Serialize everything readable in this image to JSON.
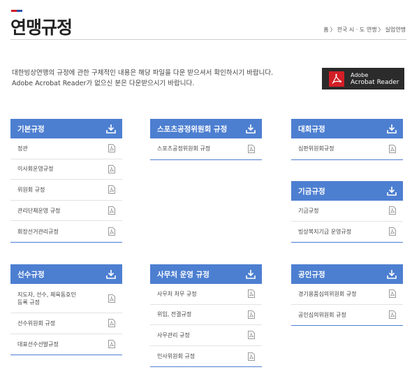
{
  "colors": {
    "accent_red": "#d31f26",
    "accent_blue": "#2c4fa6",
    "panel_header": "#4d7fd1"
  },
  "header": {
    "title": "연맹규정",
    "breadcrumb": [
      "홈",
      "전국 시 · 도 연맹",
      "실업연맹"
    ]
  },
  "intro": {
    "line1": "대한빙상연맹의 규정에 관한 구체적인 내용은 해당 파일을 다운 받으셔서 확인하시기 바랍니다.",
    "line2": "Adobe Acrobat Reader가 없으신 분은 다운받으시기 바랍니다."
  },
  "adobe": {
    "line1": "Adobe",
    "line2": "Acrobat Reader",
    "icon": "adobe-acrobat-icon"
  },
  "panels": [
    {
      "title": "기본규정",
      "items": [
        "정관",
        "이사회운영규정",
        "위원회 규정",
        "관리단체운영 규정",
        "회장선거관리규정"
      ]
    },
    {
      "title": "스포츠공정위원회 규정",
      "items": [
        "스포츠공정위원회 규정"
      ]
    },
    {
      "title": "대회규정",
      "items": [
        "심판위원회규정"
      ]
    },
    {
      "title": "기금규정",
      "items": [
        "기금규정",
        "빙상복지기금 운영규정"
      ]
    },
    {
      "title": "선수규정",
      "items": [
        "지도자, 선수, 체육동호인\n등록 규정",
        "선수위원회 규정",
        "대표선수선발규정"
      ]
    },
    {
      "title": "사무처 운영 규정",
      "items": [
        "사무처 처무 규정",
        "위임, 전결규정",
        "사무관리 규정",
        "인사위원회 규정"
      ]
    },
    {
      "title": "공인규정",
      "items": [
        "경기용품심의위원회 규정",
        "공인심의위원회 규정"
      ]
    }
  ]
}
